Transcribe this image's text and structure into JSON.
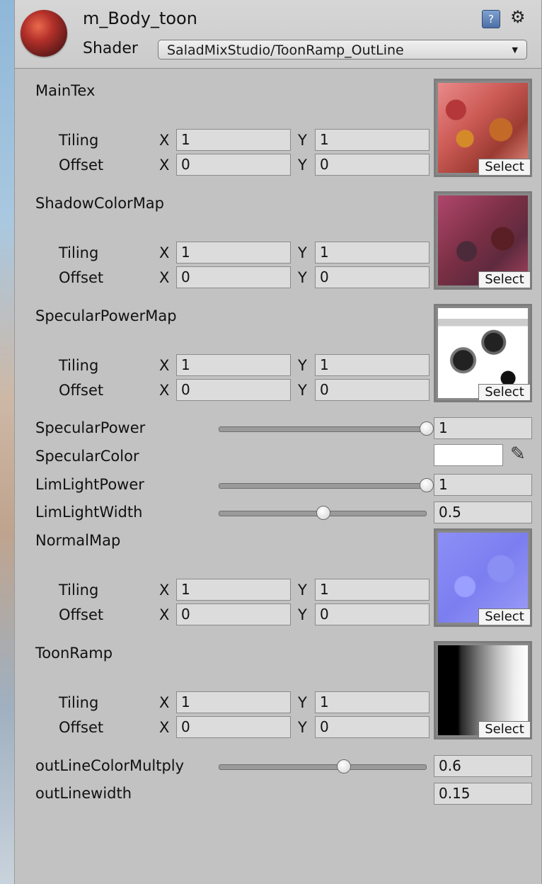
{
  "header": {
    "material_name": "m_Body_toon",
    "shader_label": "Shader",
    "shader_value": "SaladMixStudio/ToonRamp_OutLine",
    "help_icon": "?"
  },
  "common": {
    "tiling": "Tiling",
    "offset": "Offset",
    "x": "X",
    "y": "Y",
    "select": "Select"
  },
  "textures": [
    {
      "label": "MainTex",
      "tiling_x": "1",
      "tiling_y": "1",
      "offset_x": "0",
      "offset_y": "0"
    },
    {
      "label": "ShadowColorMap",
      "tiling_x": "1",
      "tiling_y": "1",
      "offset_x": "0",
      "offset_y": "0"
    },
    {
      "label": "SpecularPowerMap",
      "tiling_x": "1",
      "tiling_y": "1",
      "offset_x": "0",
      "offset_y": "0"
    },
    {
      "label": "NormalMap",
      "tiling_x": "1",
      "tiling_y": "1",
      "offset_x": "0",
      "offset_y": "0"
    },
    {
      "label": "ToonRamp",
      "tiling_x": "1",
      "tiling_y": "1",
      "offset_x": "0",
      "offset_y": "0"
    }
  ],
  "properties": {
    "specular_power": {
      "label": "SpecularPower",
      "value": "1",
      "slider_fraction": 1.0
    },
    "specular_color": {
      "label": "SpecularColor",
      "color": "#ffffff"
    },
    "lim_light_power": {
      "label": "LimLightPower",
      "value": "1",
      "slider_fraction": 1.0
    },
    "lim_light_width": {
      "label": "LimLightWidth",
      "value": "0.5",
      "slider_fraction": 0.5
    },
    "outline_color_multiply": {
      "label": "outLineColorMultply",
      "value": "0.6",
      "slider_fraction": 0.6
    },
    "outline_width": {
      "label": "outLinewidth",
      "value": "0.15"
    }
  }
}
